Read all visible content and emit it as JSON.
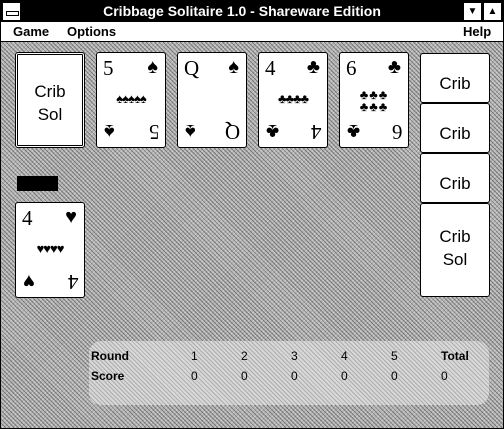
{
  "title": "Cribbage Solitaire 1.0 - Shareware Edition",
  "window_controls": {
    "minimize": "▼",
    "maximize": "▲"
  },
  "menu": {
    "game": "Game",
    "options": "Options",
    "help": "Help"
  },
  "deck": {
    "line1": "Crib",
    "line2": "Sol"
  },
  "cards": [
    {
      "rank": "5",
      "suit": "♠",
      "pips": "♠♠♠♠♠",
      "color": "#000000"
    },
    {
      "rank": "Q",
      "suit": "♠",
      "pips": "",
      "color": "#000000"
    },
    {
      "rank": "4",
      "suit": "♣",
      "pips": "♣♣♣♣",
      "color": "#000000"
    },
    {
      "rank": "6",
      "suit": "♣",
      "pips_row1": "♣♣♣",
      "pips_row2": "♣♣♣",
      "color": "#000000"
    }
  ],
  "hand_card": {
    "rank": "4",
    "suit": "♥",
    "pips": "♥♥♥♥",
    "color": "#000000"
  },
  "crib": {
    "strip_label": "Crib",
    "line1": "Crib",
    "line2": "Sol"
  },
  "score": {
    "round_label": "Round",
    "score_label": "Score",
    "rounds": [
      "1",
      "2",
      "3",
      "4",
      "5"
    ],
    "total_label": "Total",
    "scores": [
      "0",
      "0",
      "0",
      "0",
      "0"
    ],
    "total": "0"
  }
}
